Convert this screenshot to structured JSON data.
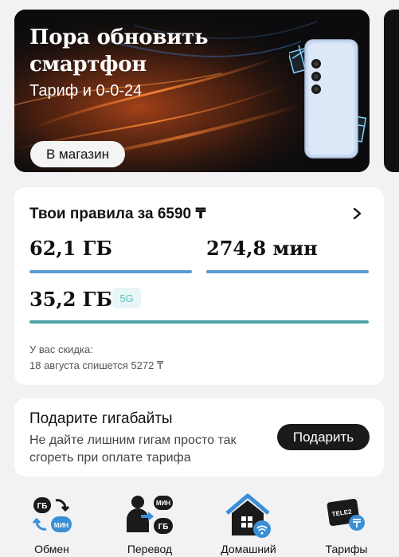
{
  "banner": {
    "title": "Пора обновить смартфон",
    "subtitle": "Тариф и 0-0-24",
    "button_label": "В магазин"
  },
  "tariff": {
    "title": "Твои правила за 6590 ₸",
    "data_amount": "62,1 ГБ",
    "minutes_amount": "274,8 мин",
    "data5g_amount": "35,2 ГБ",
    "badge_5g": "5G",
    "discount_label": "У вас скидка:",
    "discount_text": "18 августа спишется 5272 ₸",
    "colors": {
      "bar_blue": "#5b9bd5",
      "bar_teal": "#4ea3a8"
    }
  },
  "gift": {
    "title": "Подарите гигабайты",
    "description": "Не дайте лишним гигам просто так сгореть при оплате тарифа",
    "button_label": "Подарить"
  },
  "quick_actions": {
    "items": [
      {
        "label": "Обмен",
        "icon": "exchange-gb-min-icon",
        "badge_top": "ГБ",
        "badge_bottom": "МИН"
      },
      {
        "label": "Перевод",
        "icon": "transfer-icon",
        "badge_top": "МИН",
        "badge_bottom": "ГБ"
      },
      {
        "label": "Домашний",
        "icon": "home-wifi-icon"
      },
      {
        "label": "Тарифы",
        "icon": "tariffs-sim-icon",
        "badge_top": "TELE2"
      }
    ]
  }
}
